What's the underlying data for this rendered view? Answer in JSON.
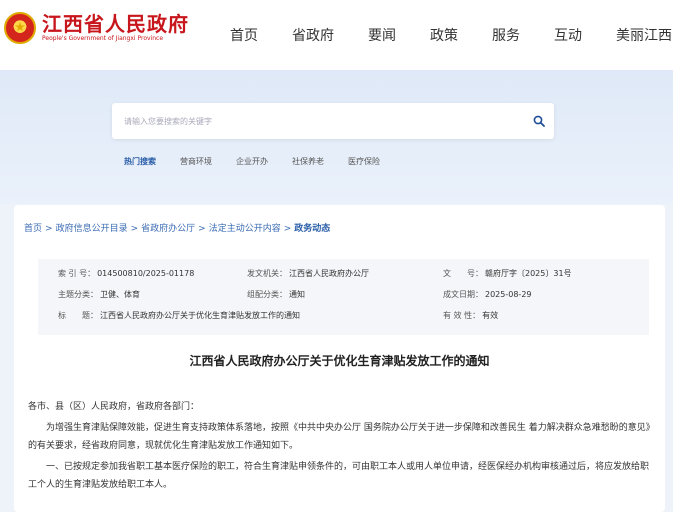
{
  "header": {
    "logo_cn": "江西省人民政府",
    "logo_en": "People's Government of Jiangxi Province",
    "nav": [
      "首页",
      "省政府",
      "要闻",
      "政策",
      "服务",
      "互动",
      "美丽江西"
    ]
  },
  "search": {
    "placeholder": "请输入您要搜索的关键字",
    "hot_label": "热门搜索",
    "hot_items": [
      "营商环境",
      "企业开办",
      "社保养老",
      "医疗保险"
    ]
  },
  "breadcrumb": {
    "items": [
      "首页",
      "政府信息公开目录",
      "省政府办公厅",
      "法定主动公开内容"
    ],
    "separator": ">",
    "current": "政务动态"
  },
  "meta": {
    "index_no_label": "索 引 号：",
    "index_no": "014500810/2025-01178",
    "issuer_label": "发文机关：",
    "issuer": "江西省人民政府办公厅",
    "doc_no_label": "文　　号：",
    "doc_no": "赣府厅字〔2025〕31号",
    "subject_label": "主题分类：",
    "subject": "卫健、体育",
    "category_label": "组配分类：",
    "category": "通知",
    "date_label": "成文日期：",
    "date": "2025-08-29",
    "title_label": "标　　题：",
    "title": "江西省人民政府办公厅关于优化生育津贴发放工作的通知",
    "validity_label": "有 效 性：",
    "validity": "有效"
  },
  "doc": {
    "title": "江西省人民政府办公厅关于优化生育津贴发放工作的通知",
    "salutation": "各市、县（区）人民政府，省政府各部门：",
    "para1": "为增强生育津贴保障效能，促进生育支持政策体系落地，按照《中共中央办公厅 国务院办公厅关于进一步保障和改善民生 着力解决群众急难愁盼的意见》的有关要求，经省政府同意，现就优化生育津贴发放工作通知如下。",
    "para2": "一、已按规定参加我省职工基本医疗保险的职工，符合生育津贴申领条件的，可由职工本人或用人单位申请，经医保经办机构审核通过后，将应发放给职工个人的生育津贴发放给职工本人。"
  }
}
